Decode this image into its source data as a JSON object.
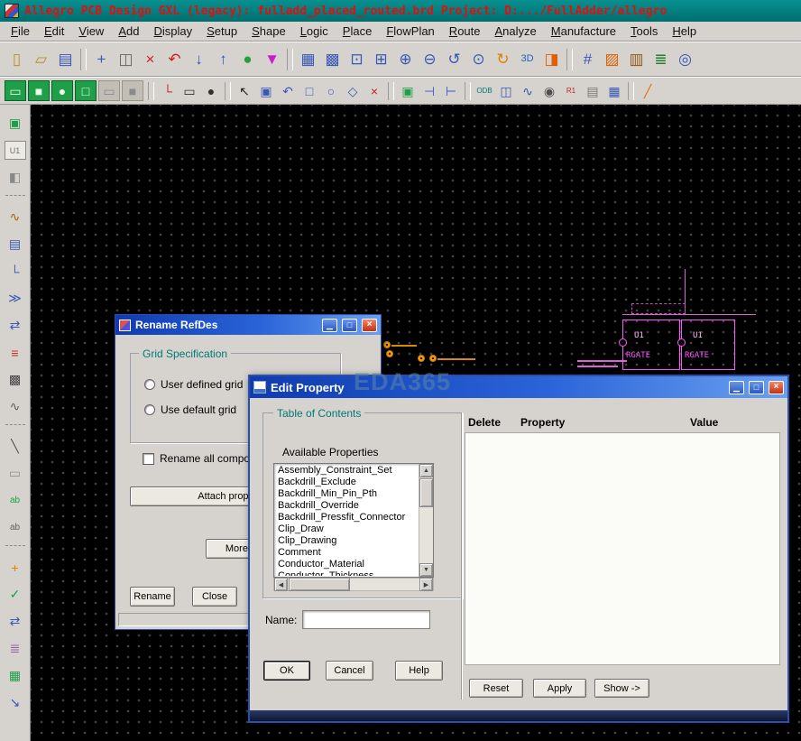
{
  "window": {
    "title": "Allegro PCB Design GXL (legacy): fulladd_placed_routed.brd  Project: D:.../FullAdder/allegro"
  },
  "window_buttons": {
    "minimize": "▁",
    "maximize": "□",
    "close": "×"
  },
  "scrollbar": {
    "up": "▲",
    "down": "▼",
    "left": "◀",
    "right": "▶"
  },
  "menu": {
    "items": [
      {
        "name": "menu-file",
        "label": "File"
      },
      {
        "name": "menu-edit",
        "label": "Edit"
      },
      {
        "name": "menu-view",
        "label": "View"
      },
      {
        "name": "menu-add",
        "label": "Add"
      },
      {
        "name": "menu-display",
        "label": "Display"
      },
      {
        "name": "menu-setup",
        "label": "Setup"
      },
      {
        "name": "menu-shape",
        "label": "Shape"
      },
      {
        "name": "menu-logic",
        "label": "Logic"
      },
      {
        "name": "menu-place",
        "label": "Place"
      },
      {
        "name": "menu-flowplan",
        "label": "FlowPlan"
      },
      {
        "name": "menu-route",
        "label": "Route"
      },
      {
        "name": "menu-analyze",
        "label": "Analyze"
      },
      {
        "name": "menu-manufacture",
        "label": "Manufacture"
      },
      {
        "name": "menu-tools",
        "label": "Tools"
      },
      {
        "name": "menu-help",
        "label": "Help"
      }
    ]
  },
  "toolbar_main": {
    "items": [
      {
        "name": "new-drawing-icon",
        "glyph": "▯",
        "color": "#b89020"
      },
      {
        "name": "open-drawing-icon",
        "glyph": "▱",
        "color": "#b89020"
      },
      {
        "name": "save-drawing-icon",
        "glyph": "▤",
        "color": "#3858b8"
      },
      {
        "name": "separator",
        "cls": "sep",
        "glyph": ""
      },
      {
        "name": "move-icon",
        "glyph": "+",
        "color": "#3858b8"
      },
      {
        "name": "copy-icon",
        "glyph": "◫",
        "color": "#666666"
      },
      {
        "name": "delete-icon",
        "glyph": "×",
        "color": "#cc2020"
      },
      {
        "name": "undo-icon",
        "glyph": "↶",
        "color": "#cc2020"
      },
      {
        "name": "download-icon",
        "glyph": "↓",
        "color": "#2858c8"
      },
      {
        "name": "upload-icon",
        "glyph": "↑",
        "color": "#2858c8"
      },
      {
        "name": "world-view-icon",
        "glyph": "●",
        "color": "#20a040"
      },
      {
        "name": "pin-icon",
        "glyph": "▼",
        "color": "#c820c8"
      },
      {
        "name": "separator",
        "cls": "sep",
        "glyph": ""
      },
      {
        "name": "grid-window-icon",
        "glyph": "▦",
        "color": "#3858b8"
      },
      {
        "name": "grid-fill-icon",
        "glyph": "▩",
        "color": "#3858b8"
      },
      {
        "name": "zoom-points-icon",
        "glyph": "⊡",
        "color": "#3858b8"
      },
      {
        "name": "zoom-fit-icon",
        "glyph": "⊞",
        "color": "#3858b8"
      },
      {
        "name": "zoom-in-icon",
        "glyph": "⊕",
        "color": "#3858b8"
      },
      {
        "name": "zoom-out-icon",
        "glyph": "⊖",
        "color": "#3858b8"
      },
      {
        "name": "zoom-previous-icon",
        "glyph": "↺",
        "color": "#3858b8"
      },
      {
        "name": "zoom-selection-icon",
        "glyph": "⊙",
        "color": "#3858b8"
      },
      {
        "name": "redraw-icon",
        "glyph": "↻",
        "color": "#e08000"
      },
      {
        "name": "view-3d-icon",
        "glyph": "3D",
        "color": "#2060c0",
        "fs": "11px"
      },
      {
        "name": "flip-design-icon",
        "glyph": "◨",
        "color": "#e06000"
      },
      {
        "name": "separator",
        "cls": "sep",
        "glyph": ""
      },
      {
        "name": "grid-toggle-icon",
        "glyph": "#",
        "color": "#3858b8"
      },
      {
        "name": "color-dialog-icon",
        "glyph": "▨",
        "color": "#e06000"
      },
      {
        "name": "swap-layers-icon",
        "glyph": "▥",
        "color": "#905818"
      },
      {
        "name": "shadow-mode-icon",
        "glyph": "≣",
        "color": "#208030"
      },
      {
        "name": "status-icon",
        "glyph": "◎",
        "color": "#3858b8"
      }
    ]
  },
  "toolbar_second": {
    "items": [
      {
        "name": "shape-add-icon",
        "glyph": "▭",
        "color": "#eaffea",
        "bg": "#1fa048",
        "cls": "chip"
      },
      {
        "name": "shape-add-rect-icon",
        "glyph": "■",
        "color": "#eaffea",
        "bg": "#1fa048",
        "cls": "chip"
      },
      {
        "name": "shape-add-circle-icon",
        "glyph": "●",
        "color": "#eaffea",
        "bg": "#1fa048",
        "cls": "chip"
      },
      {
        "name": "shape-select-icon",
        "glyph": "□",
        "color": "#eaffea",
        "bg": "#1fa048",
        "cls": "chip"
      },
      {
        "name": "shape-void-icon",
        "glyph": "▭",
        "color": "#8a8a8a",
        "bg": "#c2beb6",
        "cls": "chip2"
      },
      {
        "name": "shape-edit-icon",
        "glyph": "■",
        "color": "#8a8a8a",
        "bg": "#c2beb6",
        "cls": "chip2"
      },
      {
        "name": "separator",
        "cls": "sep",
        "glyph": ""
      },
      {
        "name": "add-line-icon",
        "glyph": "└",
        "color": "#c82020"
      },
      {
        "name": "add-rect-icon",
        "glyph": "▭",
        "color": "#303030"
      },
      {
        "name": "add-filled-circle-icon",
        "glyph": "●",
        "color": "#303030"
      },
      {
        "name": "separator",
        "cls": "sep",
        "glyph": ""
      },
      {
        "name": "pointer-icon",
        "glyph": "↖",
        "color": "#202020"
      },
      {
        "name": "window-select-icon",
        "glyph": "▣",
        "color": "#3858b8"
      },
      {
        "name": "rotate-icon",
        "glyph": "↶",
        "color": "#3858b8"
      },
      {
        "name": "rect-outline-icon",
        "glyph": "□",
        "color": "#3858b8"
      },
      {
        "name": "circle-outline-icon",
        "glyph": "○",
        "color": "#3858b8"
      },
      {
        "name": "diamond-icon",
        "glyph": "◇",
        "color": "#3858b8"
      },
      {
        "name": "delete-element-icon",
        "glyph": "×",
        "color": "#c82020"
      },
      {
        "name": "separator",
        "cls": "sep",
        "glyph": ""
      },
      {
        "name": "place-part-icon",
        "glyph": "▣",
        "color": "#1fa048"
      },
      {
        "name": "fanout-left-icon",
        "glyph": "⊣",
        "color": "#3858b8"
      },
      {
        "name": "fanout-right-icon",
        "glyph": "⊢",
        "color": "#3858b8"
      },
      {
        "name": "separator",
        "cls": "sep",
        "glyph": ""
      },
      {
        "name": "odb-export-icon",
        "glyph": "ODB",
        "color": "#007878",
        "fs": "8px"
      },
      {
        "name": "library-icon",
        "glyph": "◫",
        "color": "#3858b8"
      },
      {
        "name": "signal-probe-icon",
        "glyph": "∿",
        "color": "#3858b8"
      },
      {
        "name": "camera-icon",
        "glyph": "◉",
        "color": "#505050"
      },
      {
        "name": "refdes-tool-icon",
        "glyph": "R1",
        "color": "#c82020",
        "fs": "8px"
      },
      {
        "name": "note-icon",
        "glyph": "▤",
        "color": "#787878"
      },
      {
        "name": "grid-dialog-icon",
        "glyph": "▦",
        "color": "#3858b8"
      },
      {
        "name": "separator",
        "cls": "sep",
        "glyph": ""
      },
      {
        "name": "fix-tool-icon",
        "glyph": "╱",
        "color": "#e07000"
      }
    ]
  },
  "sidebar": {
    "items": [
      {
        "name": "place-module-icon",
        "glyph": "▣",
        "color": "#1fa048"
      },
      {
        "name": "refdes-label-icon",
        "glyph": "U1",
        "color": "#707070",
        "fs": "9px",
        "cls": "boxed"
      },
      {
        "name": "pin-tool-icon",
        "glyph": "◧",
        "color": "#888888"
      },
      {
        "name": "separator",
        "cls": "sep",
        "glyph": ""
      },
      {
        "name": "pencil-trace-icon",
        "glyph": "∿",
        "color": "#b06000"
      },
      {
        "name": "notebook-icon",
        "glyph": "▤",
        "color": "#3858b8"
      },
      {
        "name": "route-corner-icon",
        "glyph": "└",
        "color": "#3858b8"
      },
      {
        "name": "route-bus-icon",
        "glyph": "≫",
        "color": "#3858b8"
      },
      {
        "name": "route-swap-icon",
        "glyph": "⇄",
        "color": "#3858b8"
      },
      {
        "name": "layers-red-icon",
        "glyph": "≡",
        "color": "#c83030"
      },
      {
        "name": "dark-grid-icon",
        "glyph": "▩",
        "color": "#404040"
      },
      {
        "name": "impedance-icon",
        "glyph": "∿",
        "color": "#606060"
      },
      {
        "name": "separator",
        "cls": "sep",
        "glyph": ""
      },
      {
        "name": "line-tool-icon",
        "glyph": "╲",
        "color": "#505050"
      },
      {
        "name": "rect-tool-icon",
        "glyph": "▭",
        "color": "#909090"
      },
      {
        "name": "text-tool-icon",
        "glyph": "ab",
        "color": "#1fa048",
        "fs": "10px"
      },
      {
        "name": "text-edit-icon",
        "glyph": "ab",
        "color": "#606060",
        "fs": "10px"
      },
      {
        "name": "separator",
        "cls": "sep",
        "glyph": ""
      },
      {
        "name": "measure-icon",
        "glyph": "+",
        "color": "#e08000"
      },
      {
        "name": "route-check-icon",
        "glyph": "✓",
        "color": "#1fa048"
      },
      {
        "name": "route-edit-icon",
        "glyph": "⇄",
        "color": "#3858b8"
      },
      {
        "name": "layer-stack-icon",
        "glyph": "≣",
        "color": "#9060a0"
      },
      {
        "name": "green-grid-icon",
        "glyph": "▦",
        "color": "#1fa048"
      },
      {
        "name": "route-blue-icon",
        "glyph": "↘",
        "color": "#3858b8"
      }
    ]
  },
  "canvas": {
    "watermark": "EDA365",
    "components": [
      {
        "ref": "U1",
        "value": "RGATE"
      },
      {
        "ref": "U1",
        "value": "RGATE"
      }
    ]
  },
  "rename_dialog": {
    "title": "Rename RefDes",
    "grid_group_label": "Grid Specification",
    "radio_user_defined": "User defined grid",
    "radio_use_default": "Use default grid",
    "checkbox_rename_all": "Rename all compone",
    "attach_button": "Attach property, c",
    "more_button": "More...",
    "rename_button": "Rename",
    "close_button": "Close"
  },
  "edit_dialog": {
    "title": "Edit Property",
    "toc_group_label": "Table of Contents",
    "available_label": "Available Properties",
    "properties": [
      "Assembly_Constraint_Set",
      "Backdrill_Exclude",
      "Backdrill_Min_Pin_Pth",
      "Backdrill_Override",
      "Backdrill_Pressfit_Connector",
      "Clip_Draw",
      "Clip_Drawing",
      "Comment",
      "Conductor_Material",
      "Conductor_Thickness"
    ],
    "name_label": "Name:",
    "name_value": "",
    "ok_button": "OK",
    "cancel_button": "Cancel",
    "help_button": "Help",
    "columns": {
      "delete": "Delete",
      "property": "Property",
      "value": "Value"
    },
    "reset_button": "Reset",
    "apply_button": "Apply",
    "show_button": "Show ->"
  }
}
